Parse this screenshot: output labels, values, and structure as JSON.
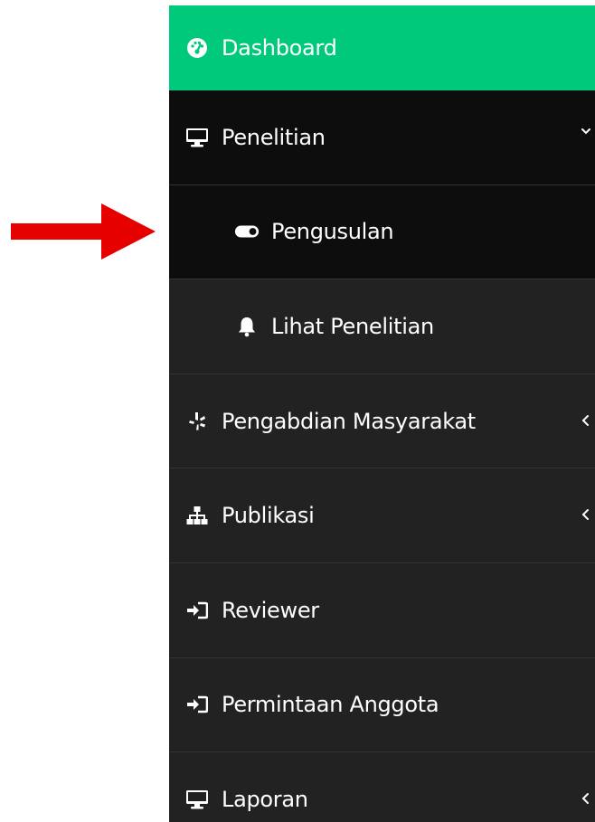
{
  "sidebar": {
    "items": [
      {
        "label": "Dashboard",
        "icon": "dashboard-icon"
      },
      {
        "label": "Penelitian",
        "icon": "desktop-icon",
        "expanded": true
      },
      {
        "label": "Pengusulan",
        "icon": "toggle-icon"
      },
      {
        "label": "Lihat Penelitian",
        "icon": "bell-icon"
      },
      {
        "label": "Pengabdian Masyarakat",
        "icon": "yelp-icon"
      },
      {
        "label": "Publikasi",
        "icon": "sitemap-icon"
      },
      {
        "label": "Reviewer",
        "icon": "sign-in-icon"
      },
      {
        "label": "Permintaan Anggota",
        "icon": "sign-in-icon"
      },
      {
        "label": "Laporan",
        "icon": "desktop-icon"
      }
    ]
  },
  "colors": {
    "active_bg": "#00c97c",
    "sidebar_bg": "#222222",
    "open_group_bg": "#0d0d0d",
    "arrow": "#e60000"
  }
}
